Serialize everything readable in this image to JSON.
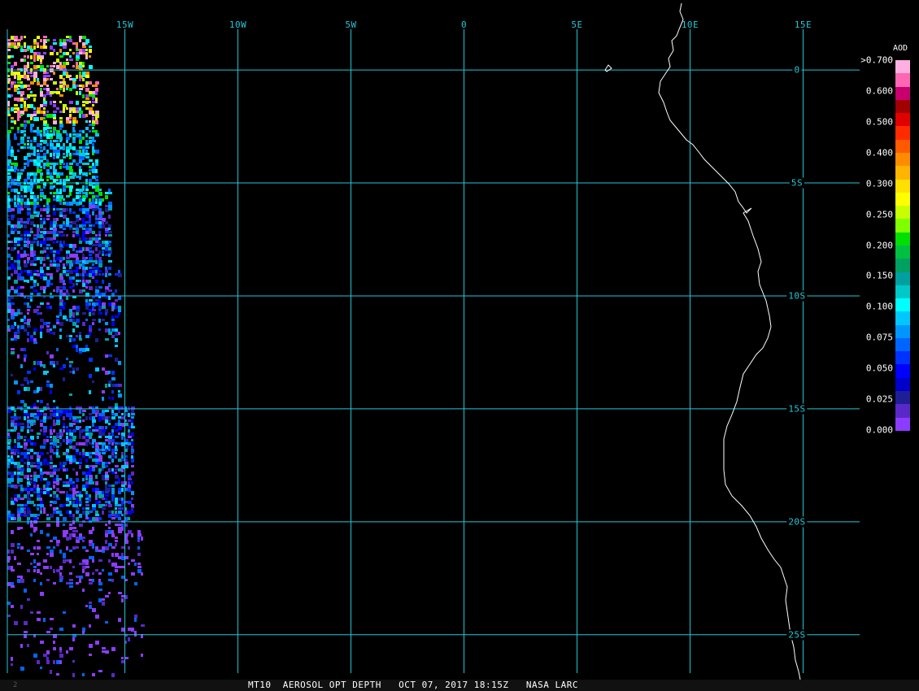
{
  "map": {
    "lon_labels": [
      {
        "value": -15,
        "label": "15W"
      },
      {
        "value": -10,
        "label": "10W"
      },
      {
        "value": -5,
        "label": "5W"
      },
      {
        "value": 0,
        "label": "0"
      },
      {
        "value": 5,
        "label": "5E"
      },
      {
        "value": 10,
        "label": "10E"
      },
      {
        "value": 15,
        "label": "15E"
      }
    ],
    "lat_labels": [
      {
        "value": 0,
        "label": "0"
      },
      {
        "value": -5,
        "label": "5S"
      },
      {
        "value": -10,
        "label": "10S"
      },
      {
        "value": -15,
        "label": "15S"
      },
      {
        "value": -20,
        "label": "20S"
      },
      {
        "value": -25,
        "label": "25S"
      }
    ],
    "extent": {
      "lon_min": -20.2,
      "lon_max": 17.5,
      "lat_min": -26.7,
      "lat_max": 3.1
    },
    "grid_color": "#20c8d8",
    "background": "#000000",
    "coastline_color": "#ffffff"
  },
  "legend": {
    "title": "AOD",
    "ticks": [
      ">0.700",
      "0.600",
      "0.500",
      "0.400",
      "0.300",
      "0.250",
      "0.200",
      "0.150",
      "0.100",
      "0.075",
      "0.050",
      "0.025",
      "0.000"
    ],
    "colors": [
      "#ffb0e0",
      "#ff66b4",
      "#c8006e",
      "#a00000",
      "#e00000",
      "#ff2a00",
      "#ff5a00",
      "#ff8c00",
      "#ffb400",
      "#ffe000",
      "#ffff00",
      "#c8ff00",
      "#80ff00",
      "#00e000",
      "#00c040",
      "#00a060",
      "#00a0a0",
      "#00c8c8",
      "#00ffff",
      "#00c8ff",
      "#0096ff",
      "#0064ff",
      "#0032ff",
      "#0000ff",
      "#0000c8",
      "#1e1e96",
      "#5a28c8",
      "#8c3cff"
    ]
  },
  "footer": {
    "text": "MT10  AEROSOL OPT DEPTH   OCT 07, 2017 18:15Z   NASA LARC",
    "corner": "2"
  }
}
